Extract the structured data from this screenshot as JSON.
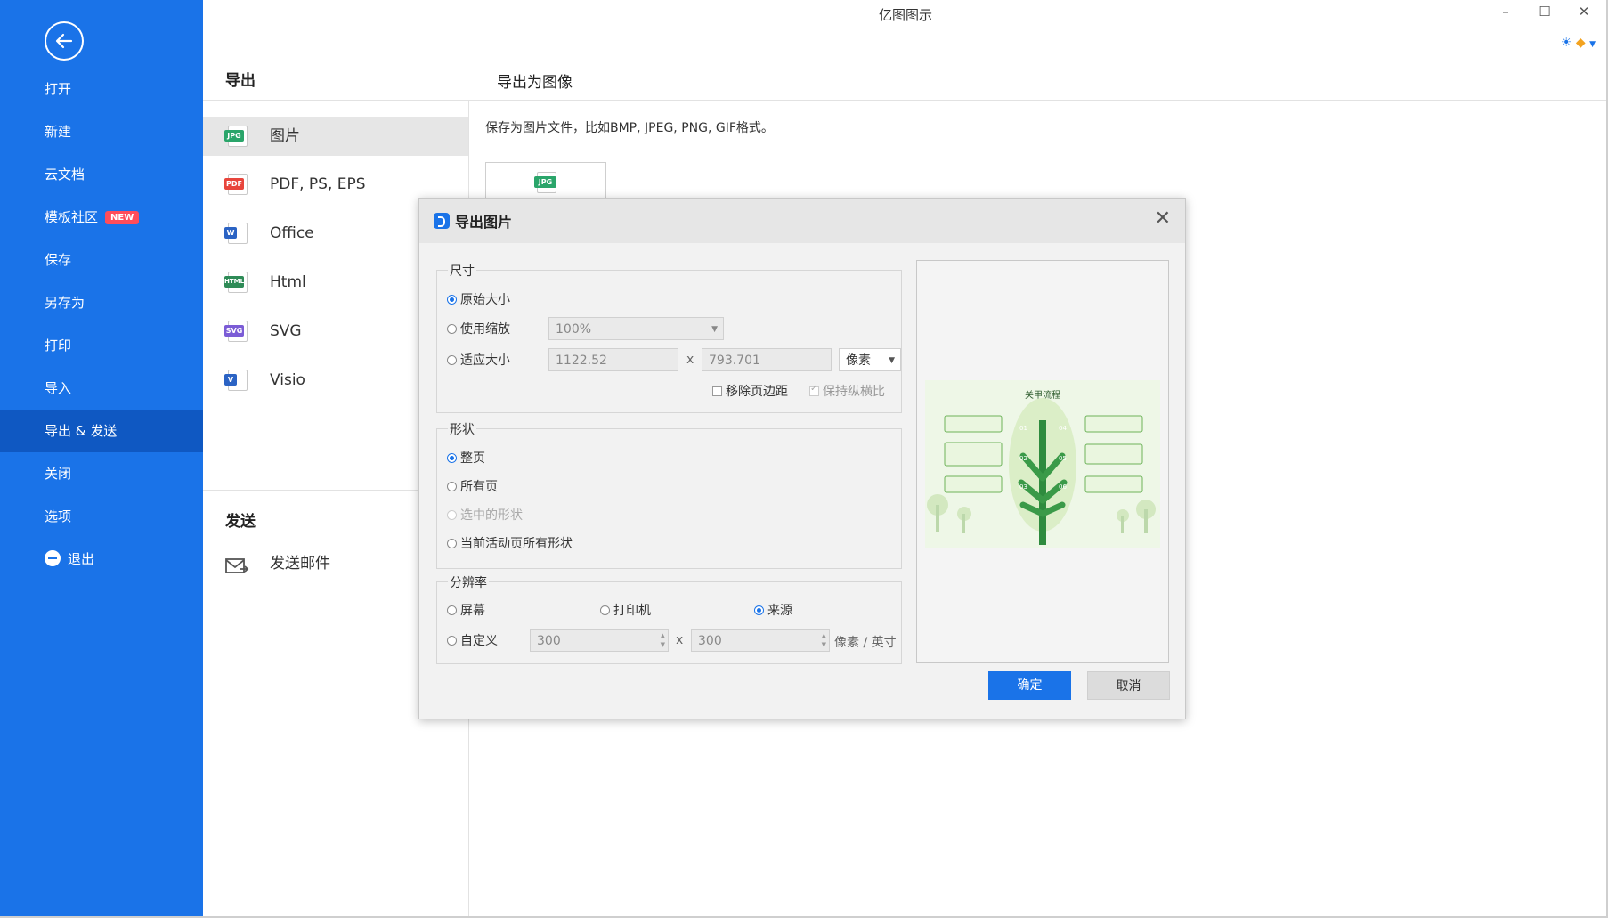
{
  "app": {
    "title": "亿图图示",
    "window_controls": {
      "minimize": "–",
      "maximize": "☐",
      "close": "✕"
    }
  },
  "sidebar": {
    "back_icon": "back-arrow-icon",
    "items": [
      {
        "label": "打开"
      },
      {
        "label": "新建"
      },
      {
        "label": "云文档"
      },
      {
        "label": "模板社区",
        "badge": "NEW"
      },
      {
        "label": "保存"
      },
      {
        "label": "另存为"
      },
      {
        "label": "打印"
      },
      {
        "label": "导入"
      },
      {
        "label": "导出 & 发送",
        "active": true
      },
      {
        "label": "关闭"
      },
      {
        "label": "选项"
      },
      {
        "label": "退出",
        "icon": "minus-circle-icon"
      }
    ]
  },
  "export": {
    "heading": "导出",
    "formats": [
      {
        "label": "图片",
        "tag": "JPG",
        "color": "#2aa56a",
        "active": true
      },
      {
        "label": "PDF, PS, EPS",
        "tag": "PDF",
        "color": "#e8453c"
      },
      {
        "label": "Office",
        "tag": "W",
        "color": "#2b63c4"
      },
      {
        "label": "Html",
        "tag": "HTML",
        "color": "#2e8b57"
      },
      {
        "label": "SVG",
        "tag": "SVG",
        "color": "#7b5cd6"
      },
      {
        "label": "Visio",
        "tag": "V",
        "color": "#2b63c4"
      }
    ]
  },
  "send": {
    "heading": "发送",
    "email_label": "发送邮件"
  },
  "main": {
    "heading": "导出为图像",
    "description": "保存为图片文件，比如BMP, JPEG, PNG, GIF格式。",
    "thumb_tag": "JPG"
  },
  "dialog": {
    "title": "导出图片",
    "close": "✕",
    "size": {
      "label": "尺寸",
      "original": "原始大小",
      "use_zoom": "使用缩放",
      "zoom_value": "100%",
      "fit_size": "适应大小",
      "width_value": "1122.52",
      "times": "x",
      "height_value": "793.701",
      "unit_value": "像素",
      "remove_margin": "移除页边距",
      "keep_ratio": "保持纵横比"
    },
    "shape": {
      "label": "形状",
      "whole_page": "整页",
      "all_pages": "所有页",
      "selected": "选中的形状",
      "active_page_all": "当前活动页所有形状"
    },
    "resolution": {
      "label": "分辨率",
      "screen": "屏幕",
      "printer": "打印机",
      "source": "来源",
      "custom": "自定义",
      "x_value": "300",
      "times": "x",
      "y_value": "300",
      "unit": "像素 / 英寸"
    },
    "preview": {
      "title": "关甲流程",
      "markers": [
        "01",
        "02",
        "03",
        "04",
        "05",
        "06"
      ]
    },
    "ok": "确定",
    "cancel": "取消"
  }
}
